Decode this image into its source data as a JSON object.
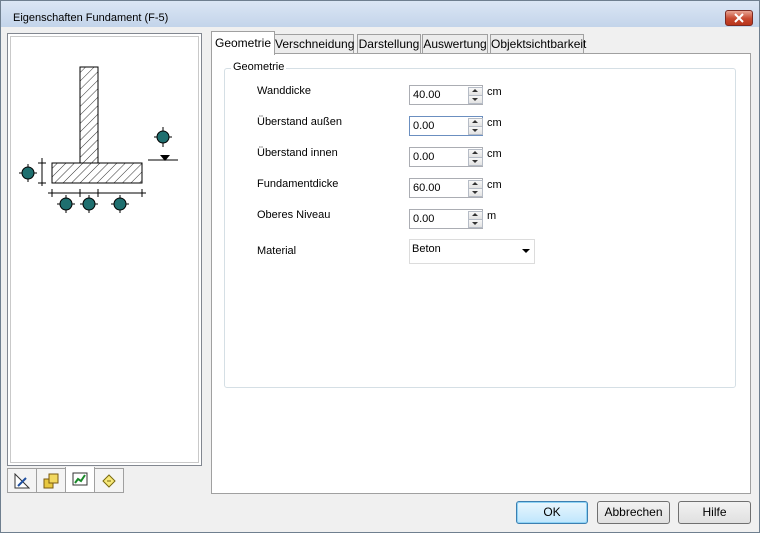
{
  "window": {
    "title": "Eigenschaften Fundament (F-5)"
  },
  "tabs": [
    "Geometrie",
    "Verschneidung",
    "Darstellung",
    "Auswertung",
    "Objektsichtbarkeit"
  ],
  "group": {
    "label": "Geometrie",
    "fields": [
      {
        "label": "Wanddicke",
        "value": "40.00",
        "unit": "cm"
      },
      {
        "label": "Überstand außen",
        "value": "0.00",
        "unit": "cm"
      },
      {
        "label": "Überstand innen",
        "value": "0.00",
        "unit": "cm"
      },
      {
        "label": "Fundamentdicke",
        "value": "60.00",
        "unit": "cm"
      },
      {
        "label": "Oberes Niveau",
        "value": "0.00",
        "unit": "m"
      }
    ],
    "material": {
      "label": "Material",
      "value": "Beton"
    }
  },
  "preview_tabs": [
    "ruler-icon",
    "layers-icon",
    "chart-icon",
    "note-icon"
  ],
  "buttons": {
    "ok": "OK",
    "cancel": "Abbrechen",
    "help": "Hilfe"
  },
  "colors": {
    "accent": "#1f6f6f",
    "hatch": "#000000",
    "default_button": "#3c7fb1"
  }
}
